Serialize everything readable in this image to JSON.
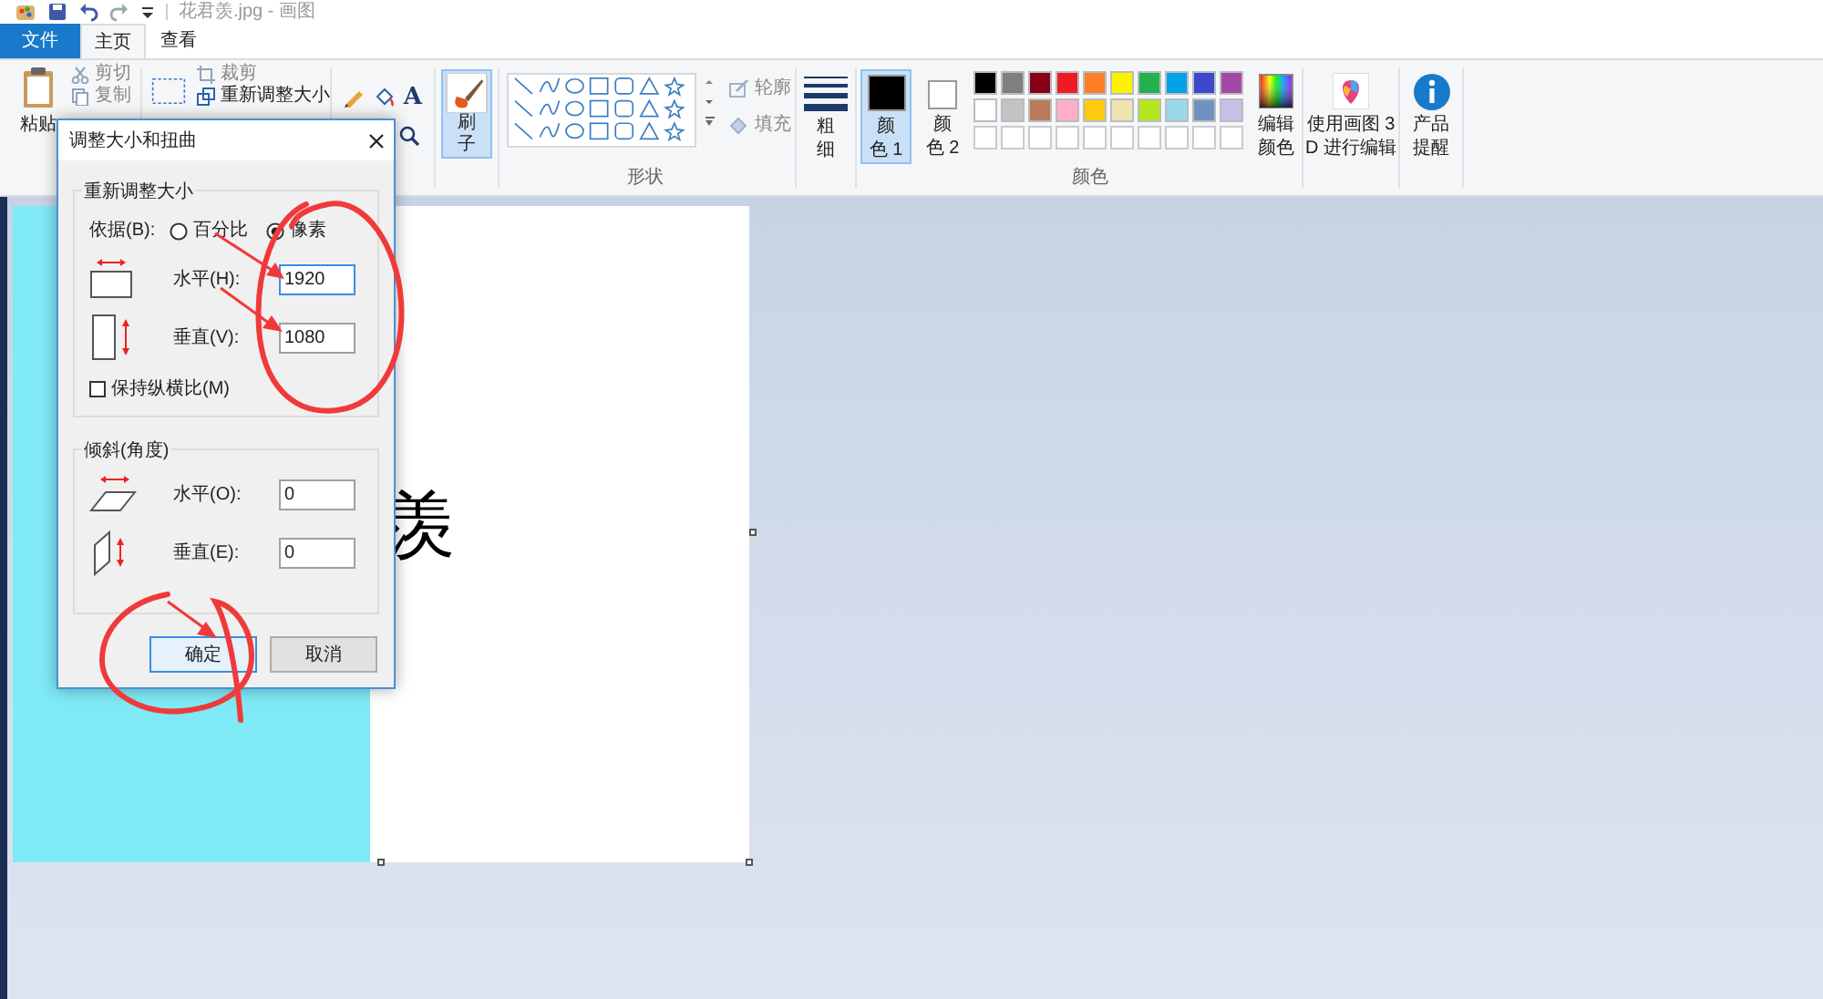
{
  "window": {
    "title": "花君羡.jpg - 画图"
  },
  "tabs": [
    {
      "label": "文件",
      "kind": "file",
      "selected": false
    },
    {
      "label": "主页",
      "kind": "tab",
      "selected": true
    },
    {
      "label": "查看",
      "kind": "tab",
      "selected": false
    }
  ],
  "ribbon": {
    "clipboard": {
      "paste": "粘贴",
      "cut": "剪切",
      "copy": "复制"
    },
    "image": {
      "crop": "裁剪",
      "resize": "重新调整大小"
    },
    "tools": {
      "text": "A"
    },
    "brushes": {
      "lines": [
        "刷",
        "子"
      ],
      "selected": true
    },
    "shapes": {
      "outline": "轮廓",
      "fill": "填充",
      "group_label": "形状"
    },
    "size": {
      "lines": [
        "粗",
        "细"
      ]
    },
    "colors": {
      "slots": [
        {
          "lines": [
            "颜",
            "色 1"
          ],
          "color": "#000000",
          "selected": true
        },
        {
          "lines": [
            "颜",
            "色 2"
          ],
          "color": "#ffffff",
          "selected": false
        }
      ],
      "palette": [
        {
          "color": "#000000"
        },
        {
          "color": "#7f7f7f"
        },
        {
          "color": "#880015"
        },
        {
          "color": "#ed1c24"
        },
        {
          "color": "#ff7f27"
        },
        {
          "color": "#fff200"
        },
        {
          "color": "#22b14c"
        },
        {
          "color": "#00a2e8"
        },
        {
          "color": "#3f48cc"
        },
        {
          "color": "#a349a4"
        },
        {
          "color": "#ffffff"
        },
        {
          "color": "#c3c3c3"
        },
        {
          "color": "#b97a57"
        },
        {
          "color": "#ffaec9"
        },
        {
          "color": "#ffc90e"
        },
        {
          "color": "#efe4b0"
        },
        {
          "color": "#b5e61d"
        },
        {
          "color": "#99d9ea"
        },
        {
          "color": "#7092be"
        },
        {
          "color": "#c8bfe7"
        }
      ],
      "edit_colors": [
        "编辑",
        "颜色"
      ],
      "group_label": "颜色"
    },
    "paint3d": [
      "使用画图 3",
      "D 进行编辑"
    ],
    "product_alert": [
      "产品",
      "提醒"
    ]
  },
  "canvas": {
    "text": "羡"
  },
  "dialog": {
    "title": "调整大小和扭曲",
    "resize": {
      "legend": "重新调整大小",
      "by_label": "依据(B):",
      "units": [
        {
          "label": "百分比",
          "selected": false
        },
        {
          "label": "像素",
          "selected": true
        }
      ],
      "horizontal": {
        "label": "水平(H):",
        "value": "1920",
        "focused": true
      },
      "vertical": {
        "label": "垂直(V):",
        "value": "1080",
        "focused": false
      },
      "keep_ratio": {
        "label": "保持纵横比(M)",
        "checked": false
      }
    },
    "skew": {
      "legend": "倾斜(角度)",
      "horizontal": {
        "label": "水平(O):",
        "value": "0",
        "focused": false
      },
      "vertical": {
        "label": "垂直(E):",
        "value": "0",
        "focused": false
      }
    },
    "buttons": [
      {
        "label": "确定",
        "default": true
      },
      {
        "label": "取消",
        "default": false
      }
    ]
  }
}
